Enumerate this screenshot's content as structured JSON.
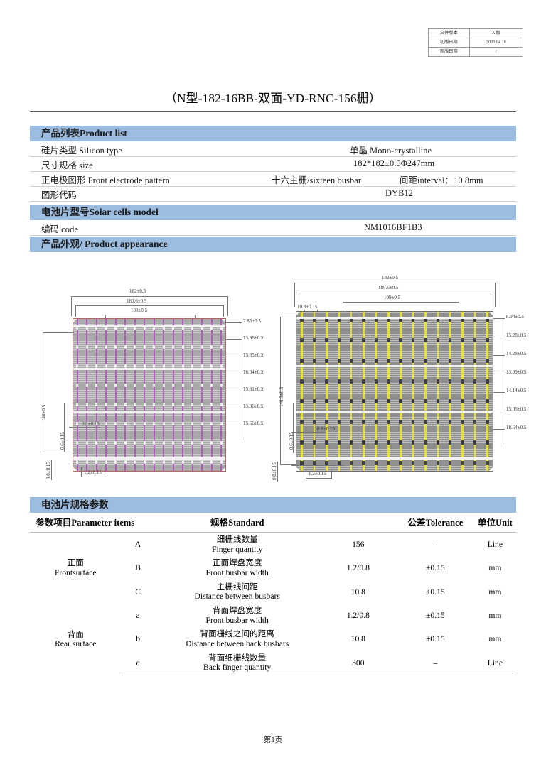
{
  "revision_table": {
    "rows": [
      {
        "key": "文件版本",
        "value": "A 版"
      },
      {
        "key": "初版日期",
        "value": "2023.04.18"
      },
      {
        "key": "新版日期",
        "value": "/"
      }
    ]
  },
  "title": "（N型-182-16BB-双面-YD-RNC-156栅）",
  "product_list": {
    "header": "产品列表Product list",
    "rows": [
      {
        "label": "硅片类型 Silicon type",
        "value": "单晶 Mono-crystalline",
        "value2": ""
      },
      {
        "label": "尺寸规格 size",
        "value": "182*182±0.5Φ247mm",
        "value2": ""
      },
      {
        "label": "正电极图形 Front electrode pattern",
        "value": "十六主栅/sixteen busbar",
        "value2": "间距interval：10.8mm"
      },
      {
        "label": "图形代码",
        "value": "DYB12",
        "value2": ""
      }
    ]
  },
  "solar_cells_model": {
    "header": "电池片型号Solar cells model",
    "rows": [
      {
        "label": "编码 code",
        "value": "NM1016BF1B3",
        "value2": ""
      }
    ]
  },
  "product_appearance": {
    "header": "产品外观/ Product appearance"
  },
  "drawings": {
    "front": {
      "top_dims": [
        "182±0.5",
        "180.6±0.5",
        "109±0.5"
      ],
      "right_dims": [
        "7.85±0.5",
        "13.96±0.5",
        "15.65±0.5",
        "16.04±0.5",
        "15.81±0.5",
        "13.86±0.5",
        "15.66±0.5"
      ],
      "left_dims": [
        "140±0.5",
        "0.6±0.15"
      ],
      "inner_dims": [
        "0.8±0.15",
        "1.2±0.15",
        "0.8±0.15"
      ],
      "busbar_color": "#b45fc0",
      "body_color": "#a8a8a8"
    },
    "rear": {
      "top_dims": [
        "182±0.5",
        "180.6±0.5",
        "109±0.5"
      ],
      "pitch_dim": "10.8±0.15",
      "right_dims": [
        "8.94±0.5",
        "15.28±0.5",
        "14.28±0.5",
        "13.99±0.5",
        "14.14±0.5",
        "15.05±0.5",
        "18.64±0.5"
      ],
      "left_dims": [
        "146.3±0.5",
        "0.6±0.15"
      ],
      "inner_dims": [
        "0.8±0.15",
        "1.2±0.15",
        "0.8±0.15"
      ],
      "busbar_color": "#e8e32a",
      "body_color": "#8f8f8f"
    }
  },
  "spec_table": {
    "header": "电池片规格参数",
    "columns": [
      "参数项目Parameter items",
      "规格Standard",
      "公差Tolerance",
      "单位Unit"
    ],
    "groups": [
      {
        "side_cn": "正面",
        "side_en": "Frontsurface",
        "rows": [
          {
            "code": "A",
            "name_cn": "细栅线数量",
            "name_en": "Finger quantity",
            "standard": "156",
            "tolerance": "–",
            "unit": "Line"
          },
          {
            "code": "B",
            "name_cn": "正面焊盘宽度",
            "name_en": "Front busbar width",
            "standard": "1.2/0.8",
            "tolerance": "±0.15",
            "unit": "mm"
          },
          {
            "code": "C",
            "name_cn": "主栅线间距",
            "name_en": "Distance between busbars",
            "standard": "10.8",
            "tolerance": "±0.15",
            "unit": "mm"
          }
        ]
      },
      {
        "side_cn": "背面",
        "side_en": "Rear surface",
        "rows": [
          {
            "code": "a",
            "name_cn": "背面焊盘宽度",
            "name_en": "Front busbar width",
            "standard": "1.2/0.8",
            "tolerance": "±0.15",
            "unit": "mm"
          },
          {
            "code": "b",
            "name_cn": "背面栅线之间的距离",
            "name_en": "Distance between back busbars",
            "standard": "10.8",
            "tolerance": "±0.15",
            "unit": "mm"
          },
          {
            "code": "c",
            "name_cn": "背面细栅线数量",
            "name_en": "Back finger quantity",
            "standard": "300",
            "tolerance": "–",
            "unit": "Line"
          }
        ]
      }
    ]
  },
  "footer": "第1页"
}
